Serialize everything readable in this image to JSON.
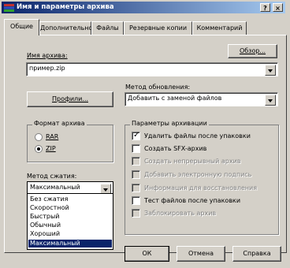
{
  "window": {
    "title": "Имя и параметры архива",
    "help_btn": "?",
    "close_btn": "×"
  },
  "tabs": [
    {
      "label": "Общие",
      "active": true
    },
    {
      "label": "Дополнительно",
      "active": false
    },
    {
      "label": "Файлы",
      "active": false
    },
    {
      "label": "Резервные копии",
      "active": false
    },
    {
      "label": "Комментарий",
      "active": false
    }
  ],
  "archive": {
    "label": "Имя архива:",
    "value": "пример.zip",
    "browse_label": "Обзор..."
  },
  "update": {
    "label": "Метод обновления:",
    "value": "Добавить с заменой файлов"
  },
  "profiles_label": "Профили...",
  "format": {
    "title": "Формат архива",
    "options": [
      {
        "label": "RAR",
        "selected": false
      },
      {
        "label": "ZIP",
        "selected": true
      }
    ]
  },
  "compression": {
    "label": "Метод сжатия:",
    "value": "Максимальный",
    "options": [
      "Без сжатия",
      "Скоростной",
      "Быстрый",
      "Обычный",
      "Хороший",
      "Максимальный"
    ],
    "selected_index": 5
  },
  "params": {
    "title": "Параметры архивации",
    "items": [
      {
        "label": "Удалить файлы после упаковки",
        "checked": true,
        "enabled": true
      },
      {
        "label": "Создать SFX-архив",
        "checked": false,
        "enabled": true
      },
      {
        "label": "Создать непрерывный архив",
        "checked": false,
        "enabled": false
      },
      {
        "label": "Добавить электронную подпись",
        "checked": false,
        "enabled": false
      },
      {
        "label": "Информация для восстановления",
        "checked": false,
        "enabled": false
      },
      {
        "label": "Тест файлов после упаковки",
        "checked": false,
        "enabled": true
      },
      {
        "label": "Заблокировать архив",
        "checked": false,
        "enabled": false
      }
    ]
  },
  "buttons": {
    "ok": "ОК",
    "cancel": "Отмена",
    "help": "Справка"
  },
  "colors": {
    "titlebar_start": "#0a246a",
    "titlebar_end": "#a6caf0",
    "face": "#d4d0c8",
    "highlight": "#0a246a"
  }
}
